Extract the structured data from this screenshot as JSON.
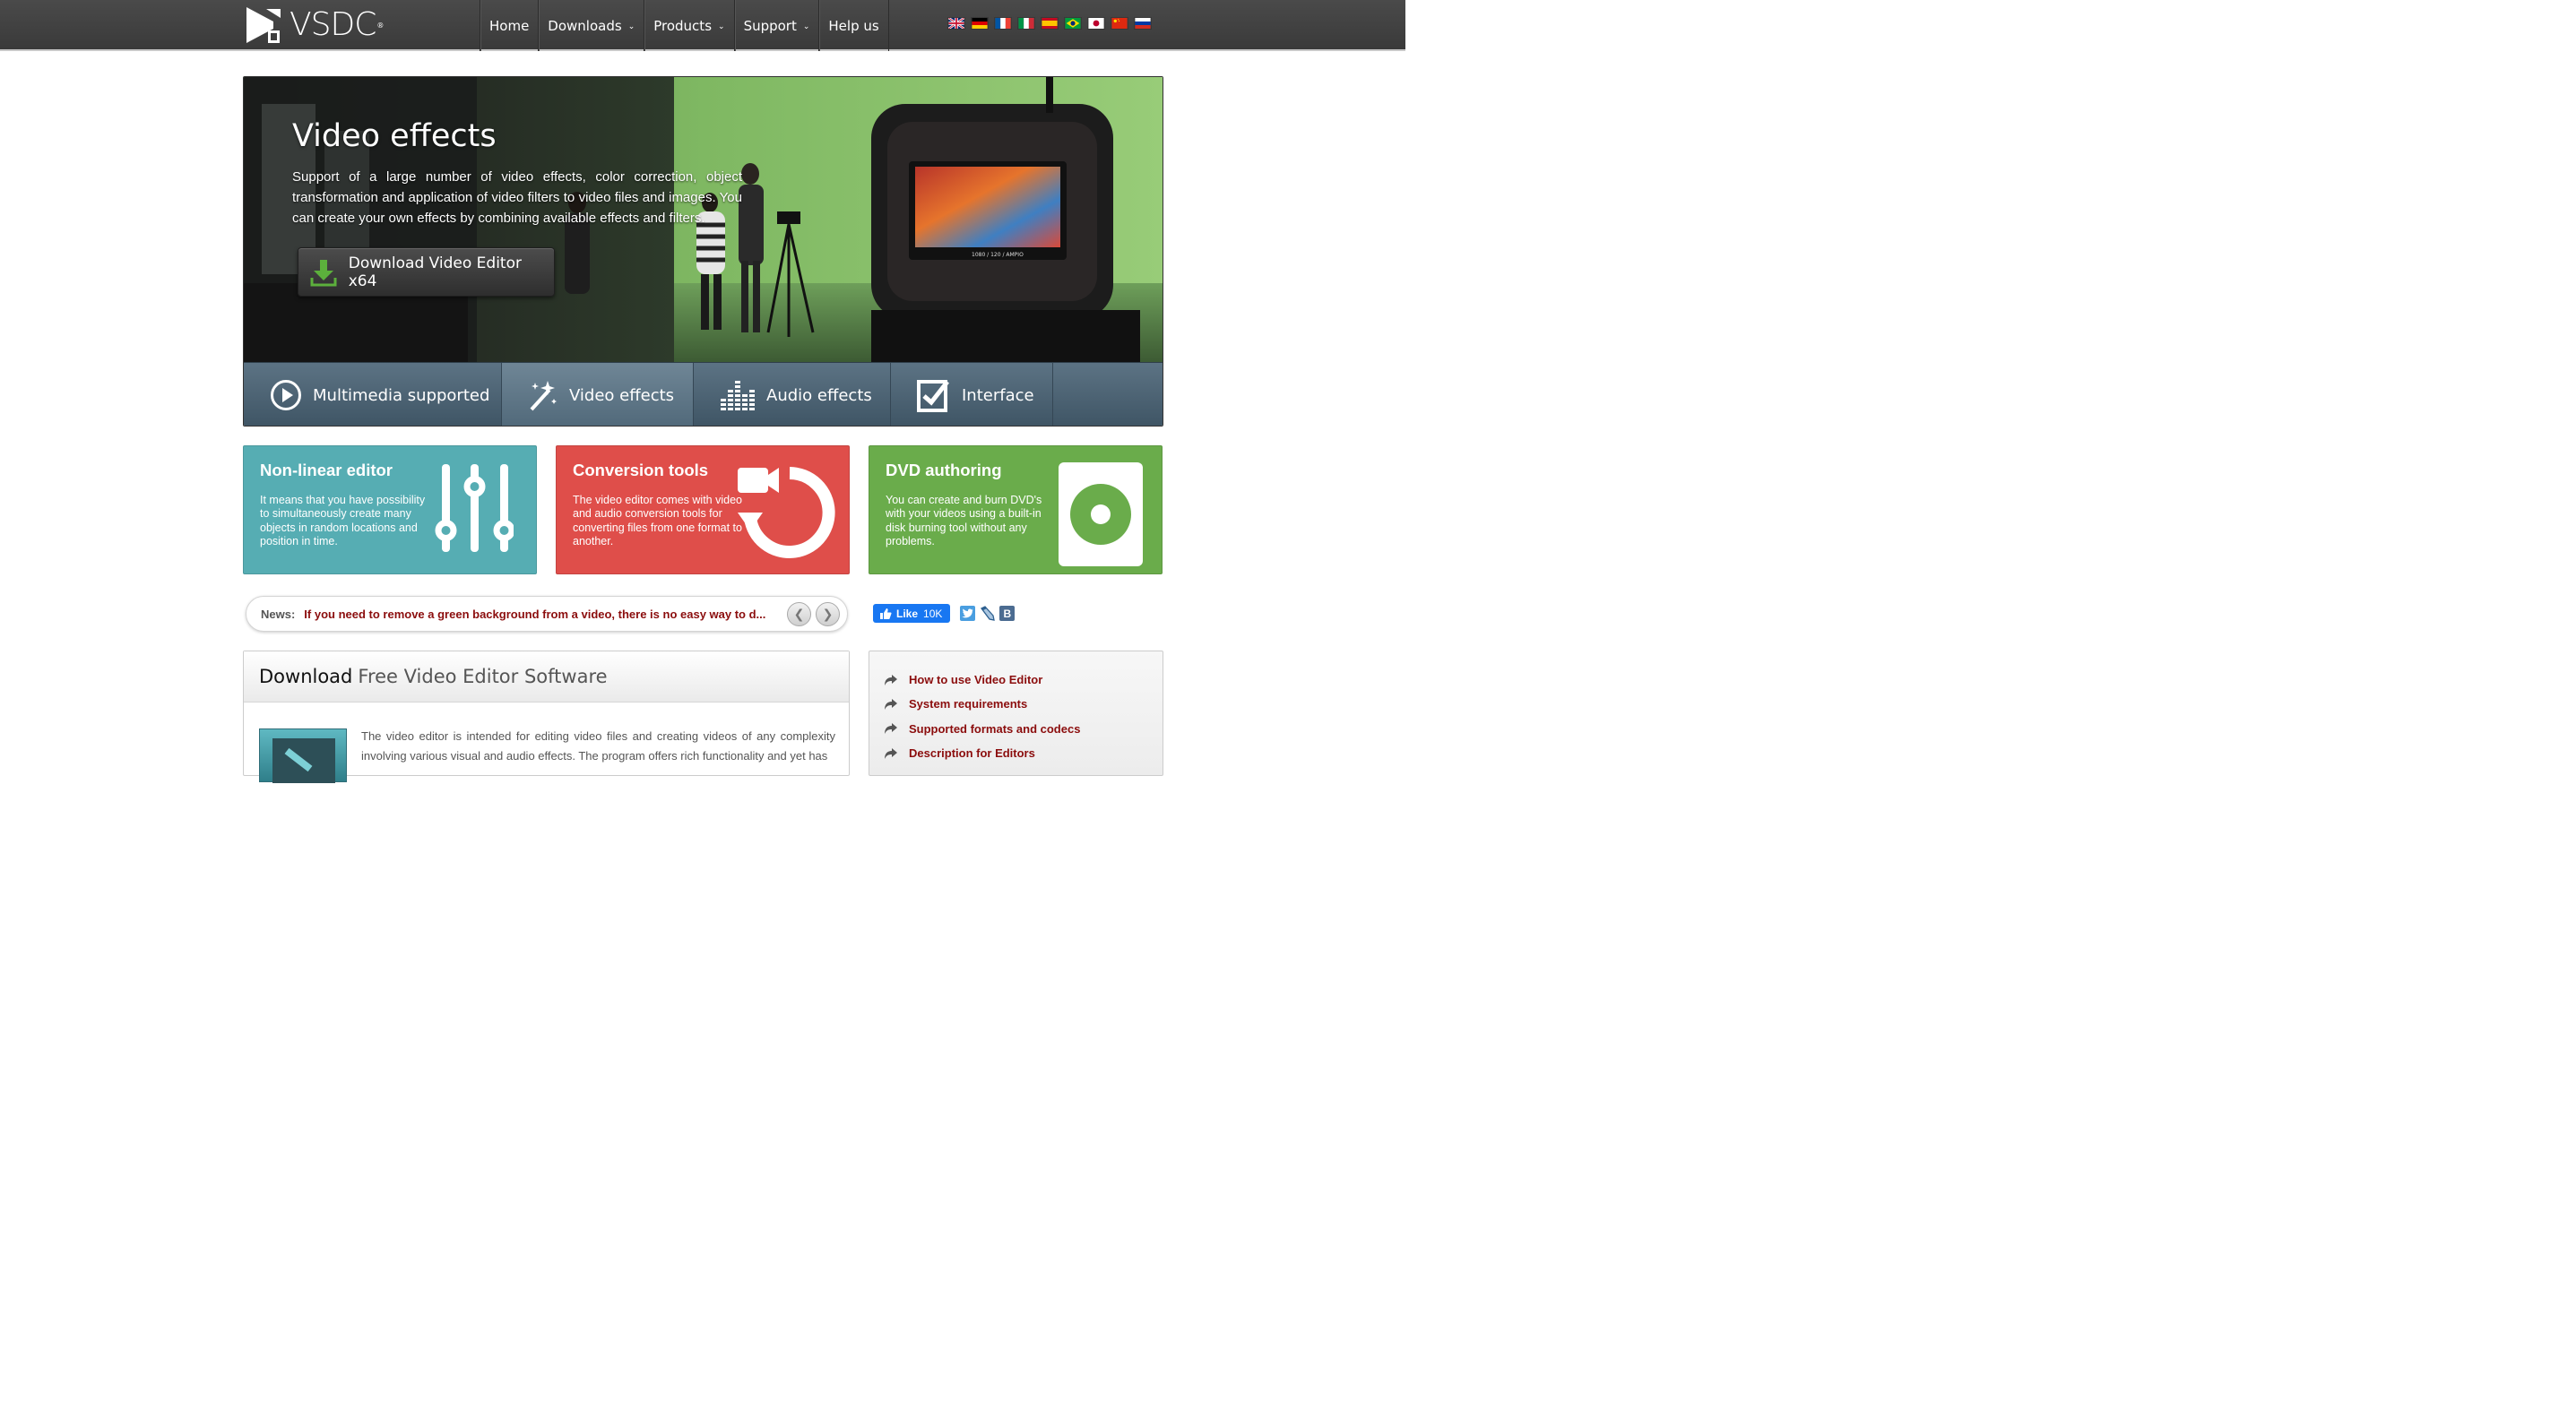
{
  "header": {
    "logo_text": "VSDC",
    "logo_mark": "®",
    "nav": [
      {
        "label": "Home",
        "has_dropdown": false
      },
      {
        "label": "Downloads",
        "has_dropdown": true
      },
      {
        "label": "Products",
        "has_dropdown": true
      },
      {
        "label": "Support",
        "has_dropdown": true
      },
      {
        "label": "Help us",
        "has_dropdown": false
      }
    ],
    "languages": [
      "flag-uk-icon",
      "flag-germany-icon",
      "flag-france-icon",
      "flag-italy-icon",
      "flag-spain-icon",
      "flag-brazil-icon",
      "flag-japan-icon",
      "flag-china-icon",
      "flag-russia-icon"
    ]
  },
  "hero": {
    "title": "Video effects",
    "description": "Support of a large number of video effects, color correction, object transformation and application of video filters to video files and images. You can create your own effects by combining available effects and filters.",
    "download_button": "Download Video Editor x64",
    "tabs": [
      {
        "label": "Multimedia supported",
        "icon": "play-circle-icon",
        "active": false
      },
      {
        "label": "Video effects",
        "icon": "magic-wand-icon",
        "active": true
      },
      {
        "label": "Audio effects",
        "icon": "equalizer-icon",
        "active": false
      },
      {
        "label": "Interface",
        "icon": "edit-checkbox-icon",
        "active": false
      }
    ]
  },
  "features": [
    {
      "title": "Non-linear editor",
      "description": "It means that you have possibility to simultaneously create many objects in random locations and position in time.",
      "color": "#56adb3",
      "icon": "sliders-icon"
    },
    {
      "title": "Conversion tools",
      "description": "The video editor comes with video and audio conversion tools for converting files from one format to another.",
      "color": "#df4e4a",
      "icon": "video-convert-icon"
    },
    {
      "title": "DVD authoring",
      "description": "You can create and burn DVD's with your videos using a built-in disk burning tool without any problems.",
      "color": "#6aac4b",
      "icon": "disc-icon"
    }
  ],
  "news": {
    "label": "News:",
    "headline": "If you need to remove a green background from a video, there is no easy way to d..."
  },
  "social": {
    "fb_like_label": "Like",
    "fb_like_count": "10K",
    "icons": [
      "twitter-icon",
      "livejournal-icon",
      "vk-icon"
    ],
    "vk_letter": "B"
  },
  "download_panel": {
    "title_main": "Download",
    "title_rest": "Free Video Editor Software",
    "text": "The video editor is intended for editing video files and creating videos of any complexity involving various visual and audio effects. The program offers rich functionality and yet has"
  },
  "side_links": [
    "How to use Video Editor",
    "System requirements",
    "Supported formats and codecs",
    "Description for Editors"
  ],
  "colors": {
    "link": "#8b0d0d",
    "topbar": "#3f3f3f",
    "hero_tabs": "#4d6374",
    "download_arrow": "#5cb03c"
  }
}
